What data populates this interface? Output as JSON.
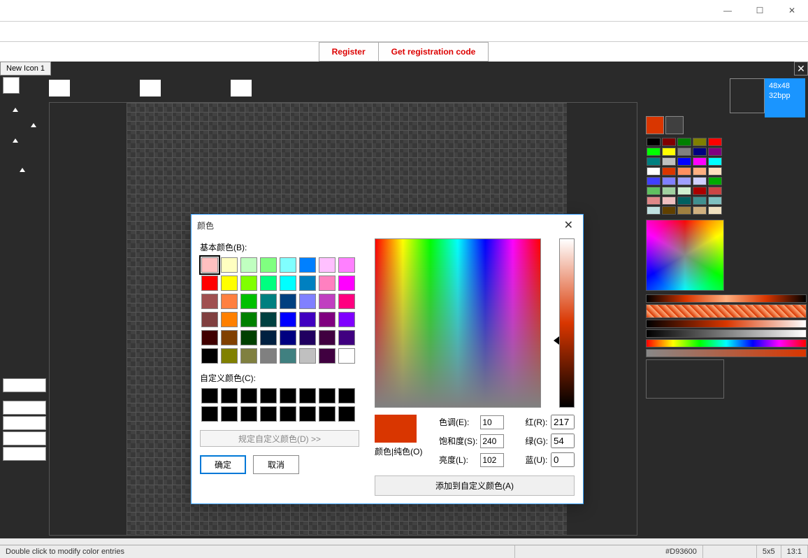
{
  "titlebar": {
    "min": "—",
    "max": "☐",
    "close": "✕"
  },
  "reg": {
    "register": "Register",
    "getcode": "Get registration code"
  },
  "tab": {
    "name": "New Icon 1",
    "close": "✕"
  },
  "fmt": {
    "dim": "48x48",
    "bpp": "32bpp"
  },
  "dlg": {
    "title": "颜色",
    "basic_label": "基本颜色(B):",
    "custom_label": "自定义颜色(C):",
    "define": "规定自定义颜色(D) >>",
    "ok": "确定",
    "cancel": "取消",
    "solid": "颜色|纯色(O)",
    "hue_l": "色调(E):",
    "sat_l": "饱和度(S):",
    "lum_l": "亮度(L):",
    "r_l": "红(R):",
    "g_l": "绿(G):",
    "b_l": "蓝(U):",
    "hue": "10",
    "sat": "240",
    "lum": "102",
    "r": "217",
    "g": "54",
    "b": "0",
    "add": "添加到自定义颜色(A)",
    "basic": [
      "#ffc0c0",
      "#ffffc0",
      "#c0ffc0",
      "#80ff80",
      "#80ffff",
      "#0080ff",
      "#ffc0ff",
      "#ff80ff",
      "#ff0000",
      "#ffff00",
      "#80ff00",
      "#00ff80",
      "#00ffff",
      "#0080c0",
      "#ff80c0",
      "#ff00ff",
      "#a05050",
      "#ff8040",
      "#00c000",
      "#008080",
      "#004080",
      "#8080ff",
      "#c040c0",
      "#ff0080",
      "#804040",
      "#ff8000",
      "#008000",
      "#004040",
      "#0000ff",
      "#4000c0",
      "#800080",
      "#8000ff",
      "#400000",
      "#804000",
      "#004000",
      "#002040",
      "#000080",
      "#200060",
      "#400040",
      "#400080",
      "#000000",
      "#808000",
      "#808040",
      "#808080",
      "#408080",
      "#c0c0c0",
      "#400040",
      "#ffffff"
    ]
  },
  "pal": [
    "#000000",
    "#800000",
    "#008000",
    "#808000",
    "#ff0000",
    "#00ff00",
    "#ffff00",
    "#808080",
    "#000080",
    "#800080",
    "#008080",
    "#c0c0c0",
    "#0000ff",
    "#ff00ff",
    "#00ffff",
    "#ffffff",
    "#d93600",
    "#ff9060",
    "#ffb080",
    "#ffe0c0",
    "#4040ff",
    "#8080ff",
    "#a0a0ff",
    "#d0d0ff",
    "#00aa00",
    "#60c060",
    "#a0d0a0",
    "#d0f0d0",
    "#aa0000",
    "#cc4444",
    "#e08888",
    "#f0c0c0",
    "#006060",
    "#409090",
    "#80c0c0",
    "#c0e0e0",
    "#604000",
    "#a08040",
    "#d0b080",
    "#f0e0c0"
  ],
  "status": {
    "hint": "Double click to modify color entries",
    "hex": "#D93600",
    "brush": "5x5",
    "zoom": "13:1"
  }
}
